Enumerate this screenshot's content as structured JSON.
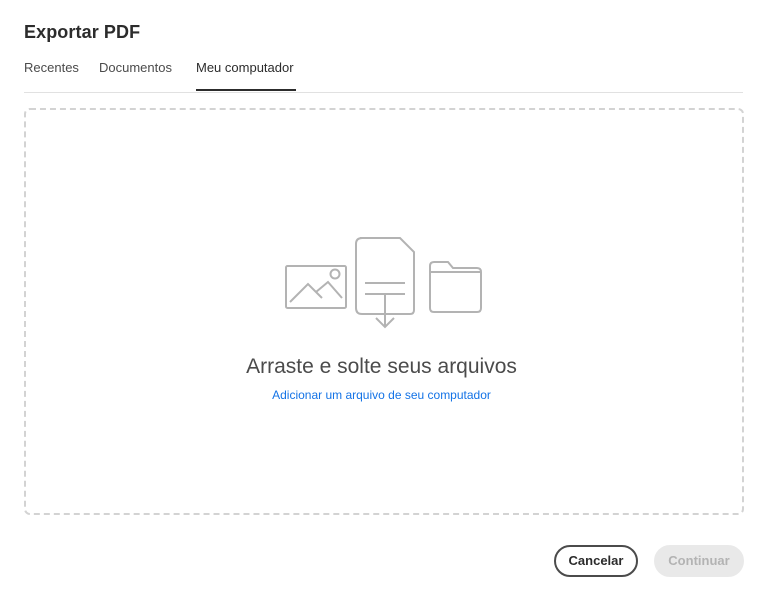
{
  "dialog": {
    "title": "Exportar PDF"
  },
  "tabs": [
    {
      "label": "Recentes",
      "selected": false
    },
    {
      "label": "Documentos",
      "selected": false
    },
    {
      "label": "Meu computador",
      "selected": true
    }
  ],
  "dropzone": {
    "title": "Arraste e solte seus arquivos",
    "link_label": "Adicionar um arquivo de seu computador",
    "icons": [
      "image-file-icon",
      "document-download-icon",
      "folder-icon"
    ]
  },
  "buttons": {
    "cancel_label": "Cancelar",
    "continue_label": "Continuar",
    "continue_enabled": false
  },
  "colors": {
    "link": "#1473e6",
    "text": "#2c2c2c",
    "disabled_bg": "#e9e9e9",
    "disabled_text": "#b3b3b3"
  }
}
